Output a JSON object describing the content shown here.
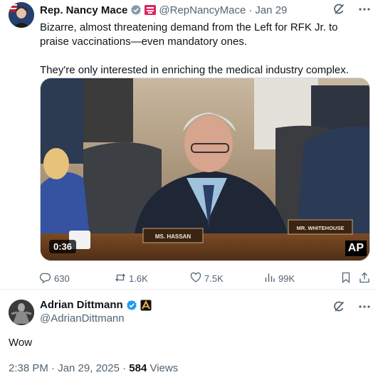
{
  "quoted_tweet": {
    "author_name": "Rep. Nancy Mace",
    "handle": "@RepNancyMace",
    "separator": "·",
    "date": "Jan 29",
    "text_line1": "Bizarre, almost threatening demand from the Left for RFK Jr. to praise vaccinations—even mandatory ones.",
    "text_line2": "They're only interested in enriching the medical industry complex.",
    "video": {
      "duration": "0:36",
      "watermark": "AP",
      "nameplate_left": "MS. HASSAN",
      "nameplate_right": "MR. WHITEHOUSE"
    },
    "stats": {
      "replies": "630",
      "reposts": "1.6K",
      "likes": "7.5K",
      "views": "99K"
    },
    "colors": {
      "verified_badge": "#829aab",
      "flag": "#e0245e"
    }
  },
  "main_tweet": {
    "author_name": "Adrian Dittmann",
    "handle": "@AdrianDittmann",
    "text": "Wow",
    "time": "2:38 PM · Jan 29, 2025",
    "separator": "·",
    "views_count": "584",
    "views_label": "Views",
    "colors": {
      "verified_badge": "#1d9bf0"
    }
  },
  "icons": {
    "grok": "grok-icon",
    "more": "more-icon",
    "reply": "reply-icon",
    "repost": "repost-icon",
    "like": "like-icon",
    "views": "views-icon",
    "bookmark": "bookmark-icon",
    "share": "share-icon"
  }
}
